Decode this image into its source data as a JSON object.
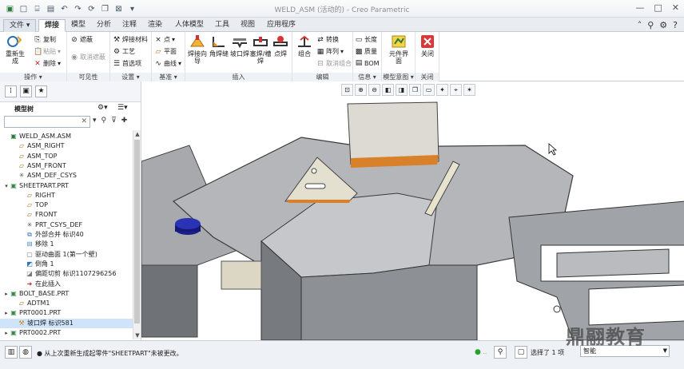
{
  "window": {
    "title": "WELD_ASM (活动的) - Creo Parametric"
  },
  "tabs": [
    {
      "label": "文件",
      "active": false
    },
    {
      "label": "焊接",
      "active": true
    },
    {
      "label": "模型",
      "active": false
    },
    {
      "label": "分析",
      "active": false
    },
    {
      "label": "注释",
      "active": false
    },
    {
      "label": "渲染",
      "active": false
    },
    {
      "label": "人体模型",
      "active": false
    },
    {
      "label": "工具",
      "active": false
    },
    {
      "label": "视图",
      "active": false
    },
    {
      "label": "应用程序",
      "active": false
    }
  ],
  "ribbon": {
    "ops": {
      "regen": "重新生成",
      "copy": "复制",
      "paste": "粘贴",
      "delete": "删除",
      "label": "操作"
    },
    "vis": {
      "hide": "遮蔽",
      "unhide": "取消遮蔽",
      "label": "可见性"
    },
    "settings": {
      "weld_mat": "焊接材料",
      "process": "工艺",
      "options": "首选项",
      "label": "设置"
    },
    "datum": {
      "point": "点",
      "plane": "平面",
      "curve": "曲线",
      "label": "基准"
    },
    "insert": {
      "weld_wizard": "焊接向导",
      "fillet": "角焊缝",
      "groove": "坡口焊",
      "plug": "塞焊/槽焊",
      "spot": "点焊",
      "label": "插入"
    },
    "edit": {
      "combine": "组合",
      "convert": "转换",
      "pattern": "阵列",
      "ungroup": "取消组合",
      "label": "编辑"
    },
    "info": {
      "length": "长度",
      "mass": "质量",
      "bom": "BOM",
      "label": "信息"
    },
    "modelview": {
      "weld_ui": "元件界面",
      "label": "模型意图"
    },
    "close": {
      "close": "关闭",
      "label": "关闭"
    }
  },
  "model_tree": {
    "title": "模型树",
    "items": [
      {
        "label": "WELD_ASM.ASM",
        "indent": 0,
        "icon": "assembly-icon",
        "twisty": ""
      },
      {
        "label": "ASM_RIGHT",
        "indent": 1,
        "icon": "datum-plane-icon",
        "twisty": ""
      },
      {
        "label": "ASM_TOP",
        "indent": 1,
        "icon": "datum-plane-icon",
        "twisty": ""
      },
      {
        "label": "ASM_FRONT",
        "indent": 1,
        "icon": "datum-plane-icon",
        "twisty": ""
      },
      {
        "label": "ASM_DEF_CSYS",
        "indent": 1,
        "icon": "csys-icon",
        "twisty": ""
      },
      {
        "label": "SHEETPART.PRT",
        "indent": 0,
        "icon": "part-icon",
        "twisty": "▾"
      },
      {
        "label": "RIGHT",
        "indent": 2,
        "icon": "datum-plane-icon",
        "twisty": ""
      },
      {
        "label": "TOP",
        "indent": 2,
        "icon": "datum-plane-icon",
        "twisty": ""
      },
      {
        "label": "FRONT",
        "indent": 2,
        "icon": "datum-plane-icon",
        "twisty": ""
      },
      {
        "label": "PRT_CSYS_DEF",
        "indent": 2,
        "icon": "csys-icon",
        "twisty": ""
      },
      {
        "label": "外部合并 标识40",
        "indent": 2,
        "icon": "merge-icon",
        "twisty": ""
      },
      {
        "label": "移除 1",
        "indent": 2,
        "icon": "remove-icon",
        "twisty": ""
      },
      {
        "label": "驱动曲面 1(第一个壁)",
        "indent": 2,
        "icon": "surface-icon",
        "twisty": ""
      },
      {
        "label": "倒角 1",
        "indent": 2,
        "icon": "chamfer-icon",
        "twisty": ""
      },
      {
        "label": "偏距切剪 标识1107296256",
        "indent": 2,
        "icon": "cut-icon",
        "twisty": ""
      },
      {
        "label": "在此插入",
        "indent": 2,
        "icon": "insert-here-icon",
        "twisty": ""
      },
      {
        "label": "BOLT_BASE.PRT",
        "indent": 0,
        "icon": "part-icon",
        "twisty": "▸"
      },
      {
        "label": "ADTM1",
        "indent": 1,
        "icon": "datum-plane-icon",
        "twisty": ""
      },
      {
        "label": "PRT0001.PRT",
        "indent": 0,
        "icon": "part-icon",
        "twisty": "▸"
      },
      {
        "label": "坡口焊 标识581",
        "indent": 1,
        "icon": "weld-icon",
        "twisty": "",
        "selected": true
      },
      {
        "label": "PRT0002.PRT",
        "indent": 0,
        "icon": "part-icon",
        "twisty": "▸"
      }
    ]
  },
  "status": {
    "message": "从上次重新生成起零件\"SHEETPART\"未被更改。",
    "selected": "选择了 1 项",
    "filter": "智能"
  },
  "watermark": "鼎翮教育"
}
